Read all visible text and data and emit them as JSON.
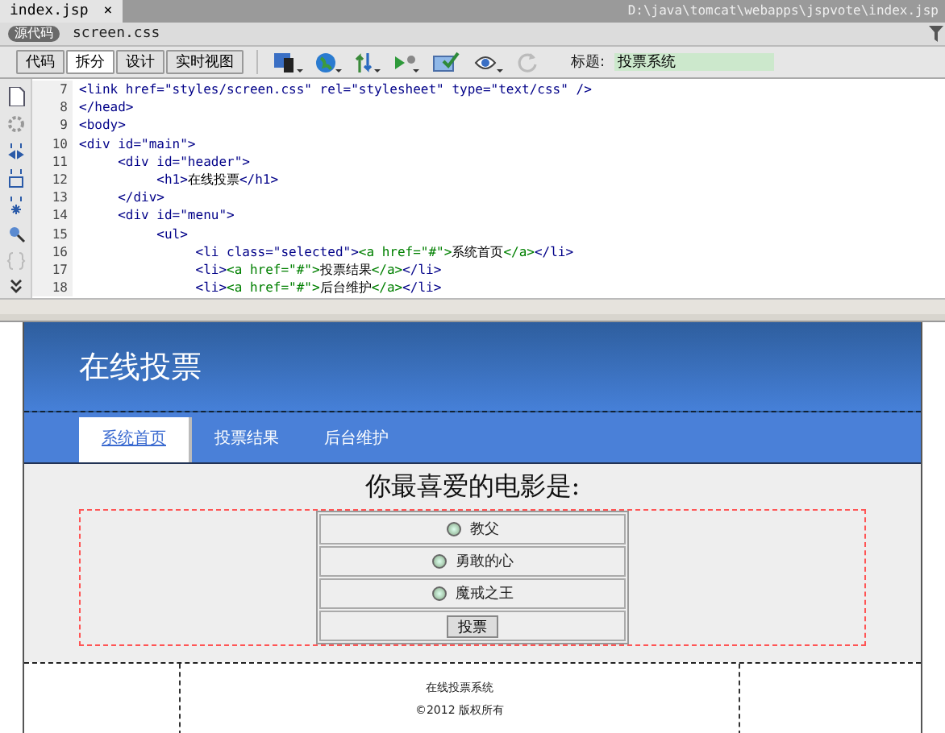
{
  "tabs": [
    {
      "label": "index.jsp",
      "close": "×",
      "selected": true
    }
  ],
  "file_path": "D:\\java\\tomcat\\webapps\\jspvote\\index.jsp",
  "source_badge": "源代码",
  "related_files": [
    "screen.css"
  ],
  "view_buttons": [
    {
      "label": "代码",
      "selected": false
    },
    {
      "label": "拆分",
      "selected": true
    },
    {
      "label": "设计",
      "selected": false
    },
    {
      "label": "实时视图",
      "selected": false
    }
  ],
  "title_label": "标题:",
  "title_value": "投票系统",
  "code_lines": [
    {
      "number": "7",
      "segments": [
        {
          "kind": "tag",
          "text": "<link href=\"styles/screen.css\" rel=\"stylesheet\" type=\"text/css\" />"
        }
      ]
    },
    {
      "number": "8",
      "segments": [
        {
          "kind": "tag",
          "text": "</head>"
        }
      ]
    },
    {
      "number": "9",
      "segments": [
        {
          "kind": "tag",
          "text": "<body>"
        }
      ]
    },
    {
      "number": "10",
      "segments": [
        {
          "kind": "tag",
          "text": "<div id=\"main\">"
        }
      ]
    },
    {
      "number": "11",
      "segments": [
        {
          "kind": "tag",
          "text": "     <div id=\"header\">"
        }
      ]
    },
    {
      "number": "12",
      "segments": [
        {
          "kind": "tag",
          "text": "          <h1>"
        },
        {
          "kind": "text",
          "text": "在线投票"
        },
        {
          "kind": "tag",
          "text": "</h1>"
        }
      ]
    },
    {
      "number": "13",
      "segments": [
        {
          "kind": "tag",
          "text": "     </div>"
        }
      ]
    },
    {
      "number": "14",
      "segments": [
        {
          "kind": "tag",
          "text": "     <div id=\"menu\">"
        }
      ]
    },
    {
      "number": "15",
      "segments": [
        {
          "kind": "tag",
          "text": "          <ul>"
        }
      ]
    },
    {
      "number": "16",
      "segments": [
        {
          "kind": "tag",
          "text": "               <li class=\"selected\">"
        },
        {
          "kind": "link",
          "text": "<a href=\"#\">"
        },
        {
          "kind": "text",
          "text": "系统首页"
        },
        {
          "kind": "link",
          "text": "</a>"
        },
        {
          "kind": "tag",
          "text": "</li>"
        }
      ]
    },
    {
      "number": "17",
      "segments": [
        {
          "kind": "tag",
          "text": "               <li>"
        },
        {
          "kind": "link",
          "text": "<a href=\"#\">"
        },
        {
          "kind": "text",
          "text": "投票结果"
        },
        {
          "kind": "link",
          "text": "</a>"
        },
        {
          "kind": "tag",
          "text": "</li>"
        }
      ]
    },
    {
      "number": "18",
      "segments": [
        {
          "kind": "tag",
          "text": "               <li>"
        },
        {
          "kind": "link",
          "text": "<a href=\"#\">"
        },
        {
          "kind": "text",
          "text": "后台维护"
        },
        {
          "kind": "link",
          "text": "</a>"
        },
        {
          "kind": "tag",
          "text": "</li>"
        }
      ]
    }
  ],
  "page": {
    "heading": "在线投票",
    "menu": [
      {
        "label": "系统首页",
        "selected": true
      },
      {
        "label": "投票结果",
        "selected": false
      },
      {
        "label": "后台维护",
        "selected": false
      }
    ],
    "question": "你最喜爱的电影是:",
    "options": [
      {
        "label": "教父",
        "selected": false
      },
      {
        "label": "勇敢的心",
        "selected": false
      },
      {
        "label": "魔戒之王",
        "selected": false
      }
    ],
    "vote_button": "投票",
    "footer": [
      "在线投票系统",
      "©2012 版权所有"
    ]
  }
}
